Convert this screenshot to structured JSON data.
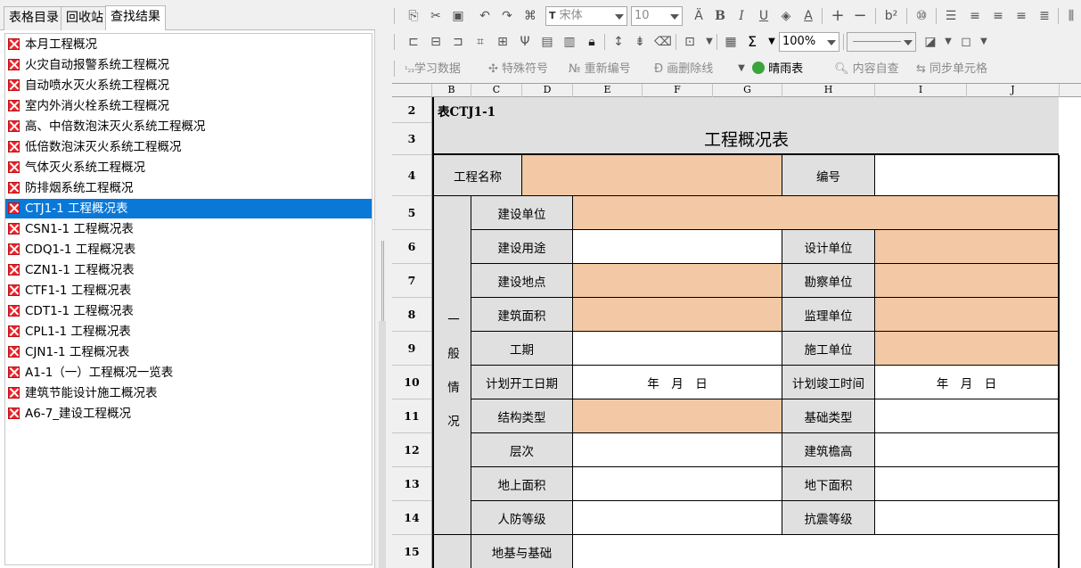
{
  "left_panel": {
    "tabs": [
      "表格目录",
      "回收站",
      "查找结果"
    ],
    "active_tab": 2,
    "tree": [
      "本月工程概况",
      "火灾自动报警系统工程概况",
      "自动喷水灭火系统工程概况",
      "室内外消火栓系统工程概况",
      "高、中倍数泡沫灭火系统工程概况",
      "低倍数泡沫灭火系统工程概况",
      "气体灭火系统工程概况",
      "防排烟系统工程概况",
      "CTJ1-1 工程概况表",
      "CSN1-1 工程概况表",
      "CDQ1-1 工程概况表",
      "CZN1-1 工程概况表",
      "CTF1-1 工程概况表",
      "CDT1-1 工程概况表",
      "CPL1-1 工程概况表",
      "CJN1-1 工程概况表",
      "A1-1（一）工程概况一览表",
      "建筑节能设计施工概况表",
      "A6-7_建设工程概况"
    ],
    "selected_index": 8
  },
  "toolbar": {
    "font_name": "宋体",
    "font_size": "10",
    "zoom": "100%",
    "sigma": "Σ",
    "row3": {
      "learn_data": "学习数据",
      "special_symbol": "特殊符号",
      "renumber": "重新编号",
      "strike_line": "画删除线",
      "weather": "晴雨表",
      "content_check": "内容自查",
      "sync_cells": "同步单元格"
    },
    "icons": [
      "copy-icon",
      "cut-icon",
      "paste-icon",
      "undo-icon",
      "redo-icon",
      "format-painter-icon",
      "bold-icon",
      "italic-icon",
      "underline-icon",
      "fill-color-icon",
      "font-color-icon",
      "plus-icon",
      "minus-icon",
      "superscript-icon",
      "circle-number-icon",
      "align-left-icon",
      "align-center-icon",
      "align-right-icon",
      "justify-icon",
      "column-icon"
    ]
  },
  "sheet": {
    "columns": [
      "B",
      "C",
      "D",
      "E",
      "F",
      "G",
      "H",
      "I",
      "J"
    ],
    "rows": [
      "2",
      "3",
      "4",
      "5",
      "6",
      "7",
      "8",
      "9",
      "10",
      "11",
      "12",
      "13",
      "14",
      "15"
    ],
    "table_code": "表CTJ1-1",
    "table_title": "工程概况表",
    "project_name_label": "工程名称",
    "number_label": "编号",
    "section_chars": [
      "一",
      "般",
      "情",
      "况"
    ],
    "fields": {
      "r5_label": "建设单位",
      "r6_label": "建设用途",
      "r6_right": "设计单位",
      "r7_label": "建设地点",
      "r7_right": "勘察单位",
      "r8_label": "建筑面积",
      "r8_right": "监理单位",
      "r9_label": "工期",
      "r9_right": "施工单位",
      "r10_label": "计划开工日期",
      "r10_date": "年　月　日",
      "r10_right": "计划竣工时间",
      "r10_date2": "年　月　日",
      "r11_label": "结构类型",
      "r11_right": "基础类型",
      "r12_label": "层次",
      "r12_right": "建筑檐高",
      "r13_label": "地上面积",
      "r13_right": "地下面积",
      "r14_label": "人防等级",
      "r14_right": "抗震等级",
      "r15_label": "地基与基础"
    }
  },
  "colors": {
    "selection": "#0a78d7",
    "input_fill": "#f2c9a4",
    "label_fill": "#e0e0e0",
    "icon_red": "#e8242a"
  }
}
